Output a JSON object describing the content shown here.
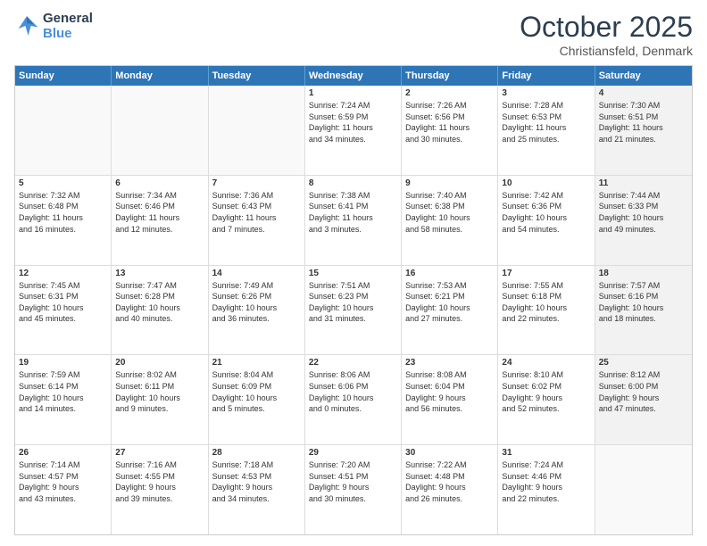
{
  "header": {
    "logo_line1": "General",
    "logo_line2": "Blue",
    "month": "October 2025",
    "location": "Christiansfeld, Denmark"
  },
  "days_of_week": [
    "Sunday",
    "Monday",
    "Tuesday",
    "Wednesday",
    "Thursday",
    "Friday",
    "Saturday"
  ],
  "weeks": [
    [
      {
        "day": "",
        "text": "",
        "shaded": true,
        "empty": true
      },
      {
        "day": "",
        "text": "",
        "shaded": true,
        "empty": true
      },
      {
        "day": "",
        "text": "",
        "shaded": true,
        "empty": true
      },
      {
        "day": "1",
        "text": "Sunrise: 7:24 AM\nSunset: 6:59 PM\nDaylight: 11 hours\nand 34 minutes.",
        "shaded": false
      },
      {
        "day": "2",
        "text": "Sunrise: 7:26 AM\nSunset: 6:56 PM\nDaylight: 11 hours\nand 30 minutes.",
        "shaded": false
      },
      {
        "day": "3",
        "text": "Sunrise: 7:28 AM\nSunset: 6:53 PM\nDaylight: 11 hours\nand 25 minutes.",
        "shaded": false
      },
      {
        "day": "4",
        "text": "Sunrise: 7:30 AM\nSunset: 6:51 PM\nDaylight: 11 hours\nand 21 minutes.",
        "shaded": true
      }
    ],
    [
      {
        "day": "5",
        "text": "Sunrise: 7:32 AM\nSunset: 6:48 PM\nDaylight: 11 hours\nand 16 minutes.",
        "shaded": false
      },
      {
        "day": "6",
        "text": "Sunrise: 7:34 AM\nSunset: 6:46 PM\nDaylight: 11 hours\nand 12 minutes.",
        "shaded": false
      },
      {
        "day": "7",
        "text": "Sunrise: 7:36 AM\nSunset: 6:43 PM\nDaylight: 11 hours\nand 7 minutes.",
        "shaded": false
      },
      {
        "day": "8",
        "text": "Sunrise: 7:38 AM\nSunset: 6:41 PM\nDaylight: 11 hours\nand 3 minutes.",
        "shaded": false
      },
      {
        "day": "9",
        "text": "Sunrise: 7:40 AM\nSunset: 6:38 PM\nDaylight: 10 hours\nand 58 minutes.",
        "shaded": false
      },
      {
        "day": "10",
        "text": "Sunrise: 7:42 AM\nSunset: 6:36 PM\nDaylight: 10 hours\nand 54 minutes.",
        "shaded": false
      },
      {
        "day": "11",
        "text": "Sunrise: 7:44 AM\nSunset: 6:33 PM\nDaylight: 10 hours\nand 49 minutes.",
        "shaded": true
      }
    ],
    [
      {
        "day": "12",
        "text": "Sunrise: 7:45 AM\nSunset: 6:31 PM\nDaylight: 10 hours\nand 45 minutes.",
        "shaded": false
      },
      {
        "day": "13",
        "text": "Sunrise: 7:47 AM\nSunset: 6:28 PM\nDaylight: 10 hours\nand 40 minutes.",
        "shaded": false
      },
      {
        "day": "14",
        "text": "Sunrise: 7:49 AM\nSunset: 6:26 PM\nDaylight: 10 hours\nand 36 minutes.",
        "shaded": false
      },
      {
        "day": "15",
        "text": "Sunrise: 7:51 AM\nSunset: 6:23 PM\nDaylight: 10 hours\nand 31 minutes.",
        "shaded": false
      },
      {
        "day": "16",
        "text": "Sunrise: 7:53 AM\nSunset: 6:21 PM\nDaylight: 10 hours\nand 27 minutes.",
        "shaded": false
      },
      {
        "day": "17",
        "text": "Sunrise: 7:55 AM\nSunset: 6:18 PM\nDaylight: 10 hours\nand 22 minutes.",
        "shaded": false
      },
      {
        "day": "18",
        "text": "Sunrise: 7:57 AM\nSunset: 6:16 PM\nDaylight: 10 hours\nand 18 minutes.",
        "shaded": true
      }
    ],
    [
      {
        "day": "19",
        "text": "Sunrise: 7:59 AM\nSunset: 6:14 PM\nDaylight: 10 hours\nand 14 minutes.",
        "shaded": false
      },
      {
        "day": "20",
        "text": "Sunrise: 8:02 AM\nSunset: 6:11 PM\nDaylight: 10 hours\nand 9 minutes.",
        "shaded": false
      },
      {
        "day": "21",
        "text": "Sunrise: 8:04 AM\nSunset: 6:09 PM\nDaylight: 10 hours\nand 5 minutes.",
        "shaded": false
      },
      {
        "day": "22",
        "text": "Sunrise: 8:06 AM\nSunset: 6:06 PM\nDaylight: 10 hours\nand 0 minutes.",
        "shaded": false
      },
      {
        "day": "23",
        "text": "Sunrise: 8:08 AM\nSunset: 6:04 PM\nDaylight: 9 hours\nand 56 minutes.",
        "shaded": false
      },
      {
        "day": "24",
        "text": "Sunrise: 8:10 AM\nSunset: 6:02 PM\nDaylight: 9 hours\nand 52 minutes.",
        "shaded": false
      },
      {
        "day": "25",
        "text": "Sunrise: 8:12 AM\nSunset: 6:00 PM\nDaylight: 9 hours\nand 47 minutes.",
        "shaded": true
      }
    ],
    [
      {
        "day": "26",
        "text": "Sunrise: 7:14 AM\nSunset: 4:57 PM\nDaylight: 9 hours\nand 43 minutes.",
        "shaded": false
      },
      {
        "day": "27",
        "text": "Sunrise: 7:16 AM\nSunset: 4:55 PM\nDaylight: 9 hours\nand 39 minutes.",
        "shaded": false
      },
      {
        "day": "28",
        "text": "Sunrise: 7:18 AM\nSunset: 4:53 PM\nDaylight: 9 hours\nand 34 minutes.",
        "shaded": false
      },
      {
        "day": "29",
        "text": "Sunrise: 7:20 AM\nSunset: 4:51 PM\nDaylight: 9 hours\nand 30 minutes.",
        "shaded": false
      },
      {
        "day": "30",
        "text": "Sunrise: 7:22 AM\nSunset: 4:48 PM\nDaylight: 9 hours\nand 26 minutes.",
        "shaded": false
      },
      {
        "day": "31",
        "text": "Sunrise: 7:24 AM\nSunset: 4:46 PM\nDaylight: 9 hours\nand 22 minutes.",
        "shaded": false
      },
      {
        "day": "",
        "text": "",
        "shaded": true,
        "empty": true
      }
    ]
  ]
}
